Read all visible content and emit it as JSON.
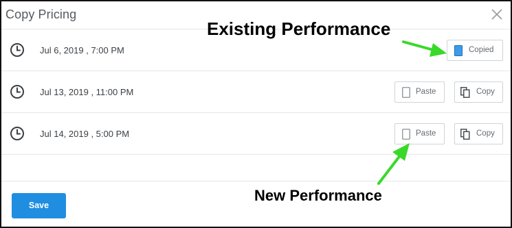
{
  "dialog": {
    "title": "Copy Pricing",
    "close_icon": "close-icon"
  },
  "rows": [
    {
      "date": "Jul 6, 2019 , 7:00 PM",
      "icon": "clock-icon",
      "buttons": [
        {
          "label": "Copied",
          "icon": "clipboard-filled-icon",
          "accent": "#3d9be9"
        }
      ]
    },
    {
      "date": "Jul 13, 2019 , 11:00 PM",
      "icon": "clock-icon",
      "buttons": [
        {
          "label": "Paste",
          "icon": "clipboard-icon"
        },
        {
          "label": "Copy",
          "icon": "copy-icon"
        }
      ]
    },
    {
      "date": "Jul 14, 2019 , 5:00 PM",
      "icon": "clock-icon",
      "buttons": [
        {
          "label": "Paste",
          "icon": "clipboard-icon"
        },
        {
          "label": "Copy",
          "icon": "copy-icon"
        }
      ]
    }
  ],
  "footer": {
    "save_label": "Save",
    "save_color": "#1f8ee0"
  },
  "annotations": {
    "existing": "Existing Performance",
    "new": "New Performance",
    "arrow_color": "#39d92a"
  }
}
